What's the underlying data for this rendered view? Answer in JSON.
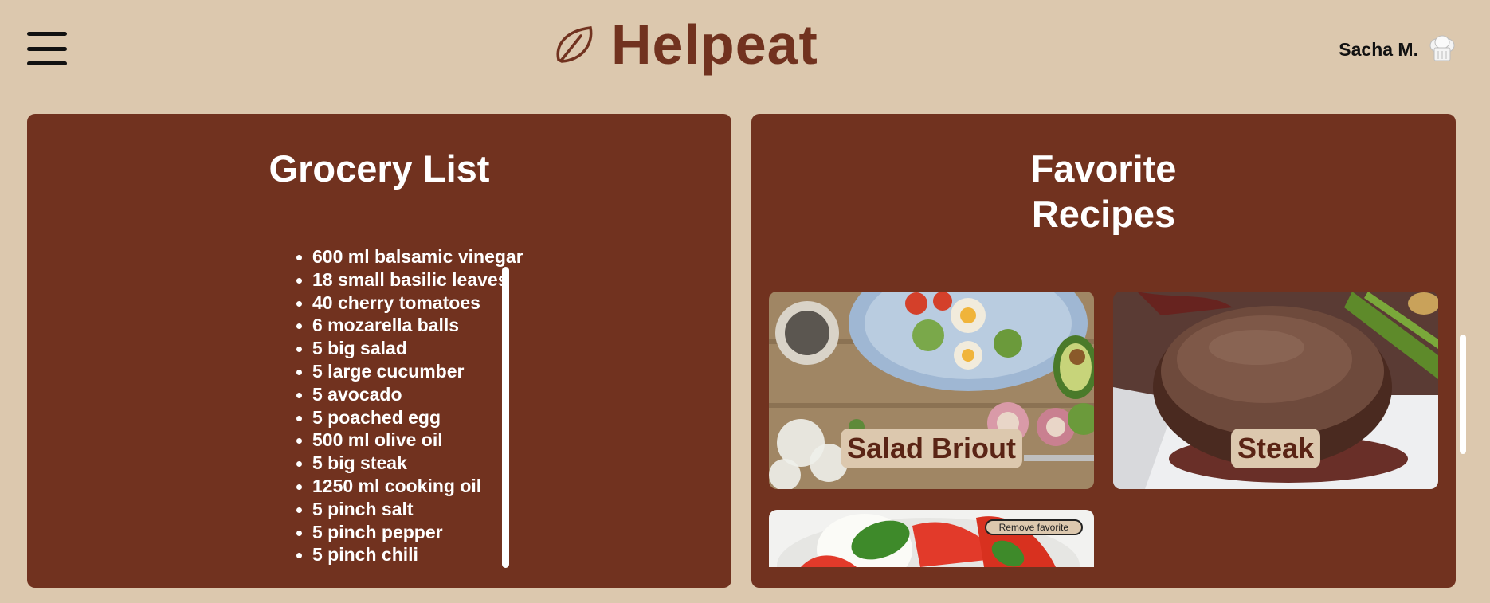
{
  "header": {
    "app_name": "Helpeat",
    "user_name": "Sacha M."
  },
  "grocery": {
    "title": "Grocery List",
    "items": [
      "600 ml balsamic vinegar",
      "18 small basilic leaves",
      "40 cherry tomatoes",
      "6 mozarella balls",
      "5 big salad",
      "5 large cucumber",
      "5 avocado",
      "5 poached egg",
      "500 ml olive oil",
      "5 big steak",
      "1250 ml cooking oil",
      "5 pinch salt",
      "5 pinch pepper",
      "5 pinch chili"
    ]
  },
  "favorites": {
    "title_line1": "Favorite",
    "title_line2": "Recipes",
    "recipes": [
      {
        "label": "Salad Briout"
      },
      {
        "label": "Steak"
      },
      {
        "remove_label": "Remove favorite"
      }
    ]
  },
  "icons": {
    "menu": "hamburger-menu-icon",
    "logo": "leaf-logo-icon",
    "user": "chef-hat-icon"
  },
  "colors": {
    "background": "#dcc8ae",
    "panel": "#71321f",
    "brand": "#71321f"
  }
}
